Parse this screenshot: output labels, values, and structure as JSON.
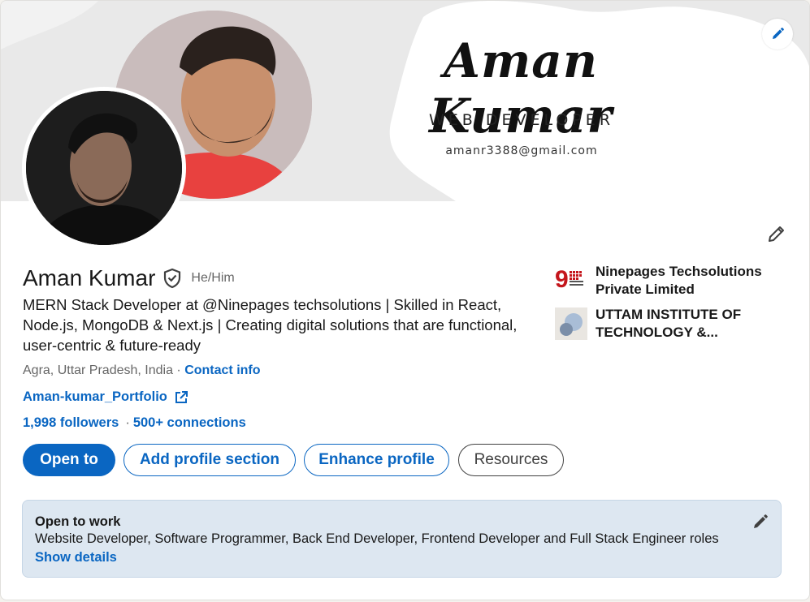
{
  "banner": {
    "signature": "Aman Kumar",
    "role": "WEB DEVELOPER",
    "email": "amanr3388@gmail.com"
  },
  "profile": {
    "name": "Aman Kumar",
    "pronouns": "He/Him",
    "headline": "MERN Stack Developer at @Ninepages techsolutions | Skilled in React, Node.js, MongoDB & Next.js | Creating digital solutions that are functional, user-centric & future-ready",
    "location": "Agra, Uttar Pradesh, India",
    "location_sep": " · ",
    "contact_info": "Contact info",
    "portfolio": "Aman-kumar_Portfolio",
    "followers": "1,998 followers",
    "stats_sep": "·",
    "connections": "500+ connections"
  },
  "actions": {
    "open_to": "Open to",
    "add_section": "Add profile section",
    "enhance": "Enhance profile",
    "resources": "Resources"
  },
  "orgs": [
    {
      "name": "Ninepages Techsolutions Private Limited",
      "icon": "ninepages-logo"
    },
    {
      "name": "UTTAM INSTITUTE OF TECHNOLOGY &...",
      "icon": "school-logo"
    }
  ],
  "open_to_work": {
    "title": "Open to work",
    "roles": "Website Developer, Software Programmer, Back End Developer, Frontend Developer and Full Stack Engineer roles",
    "link": "Show details"
  },
  "colors": {
    "brand": "#0a66c2",
    "otw_bg": "#dde7f1"
  }
}
